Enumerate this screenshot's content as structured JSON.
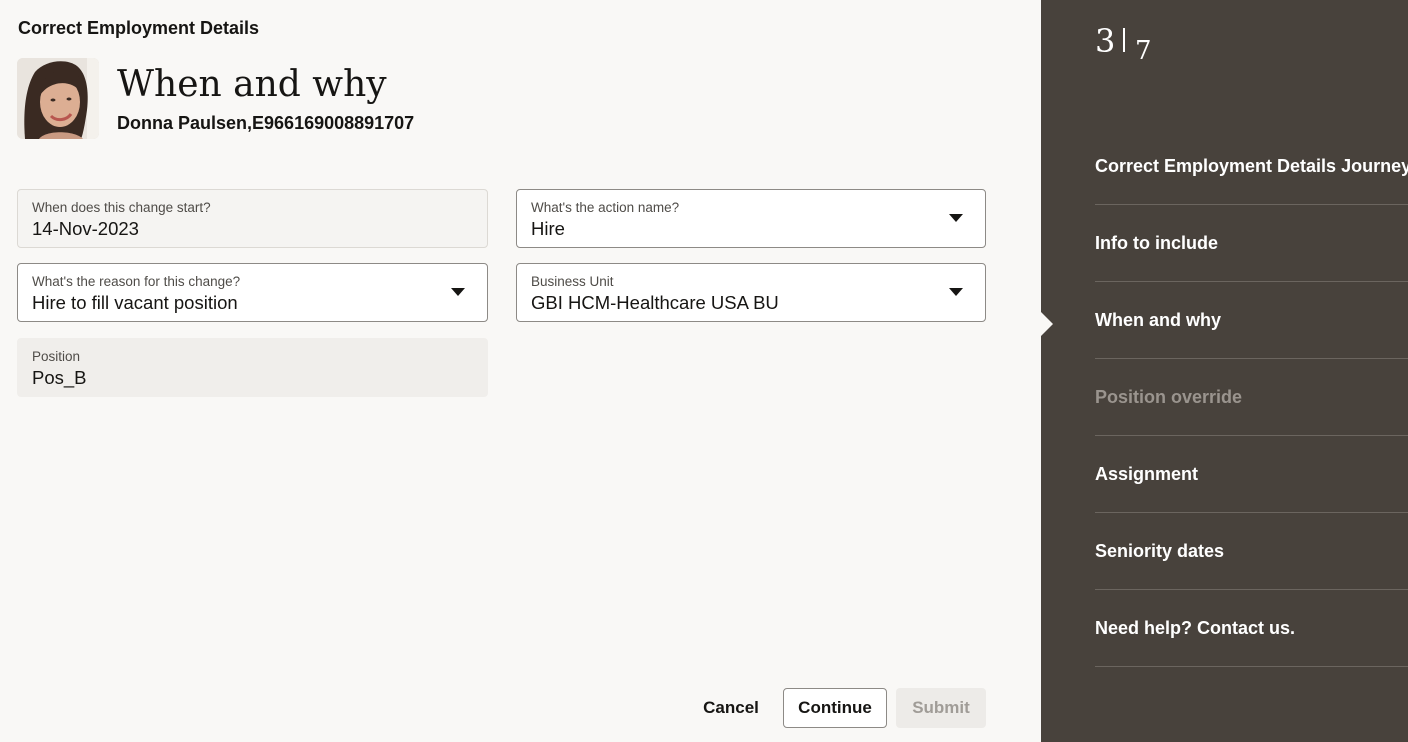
{
  "header": {
    "title": "Correct Employment Details"
  },
  "page": {
    "heading": "When and why",
    "person": "Donna Paulsen,E966169008891707"
  },
  "fields": {
    "start_date": {
      "label": "When does this change start?",
      "value": "14-Nov-2023"
    },
    "action_name": {
      "label": "What's the action name?",
      "value": "Hire"
    },
    "reason": {
      "label": "What's the reason for this change?",
      "value": "Hire to fill vacant position"
    },
    "business_unit": {
      "label": "Business Unit",
      "value": "GBI HCM-Healthcare USA BU"
    },
    "position": {
      "label": "Position",
      "value": "Pos_B"
    }
  },
  "actions": {
    "cancel": "Cancel",
    "continue": "Continue",
    "submit": "Submit"
  },
  "progress": {
    "current": "3",
    "total": "7"
  },
  "sidebar": {
    "items": [
      {
        "label": "Correct Employment Details Journey",
        "state": "enabled"
      },
      {
        "label": "Info to include",
        "state": "enabled"
      },
      {
        "label": "When and why",
        "state": "current"
      },
      {
        "label": "Position override",
        "state": "disabled"
      },
      {
        "label": "Assignment",
        "state": "enabled"
      },
      {
        "label": "Seniority dates",
        "state": "enabled"
      },
      {
        "label": "Need help? Contact us.",
        "state": "enabled"
      }
    ]
  },
  "colors": {
    "sidebar_bg": "#48423c",
    "page_bg": "#f9f8f6",
    "disabled_text": "#9a948e"
  }
}
